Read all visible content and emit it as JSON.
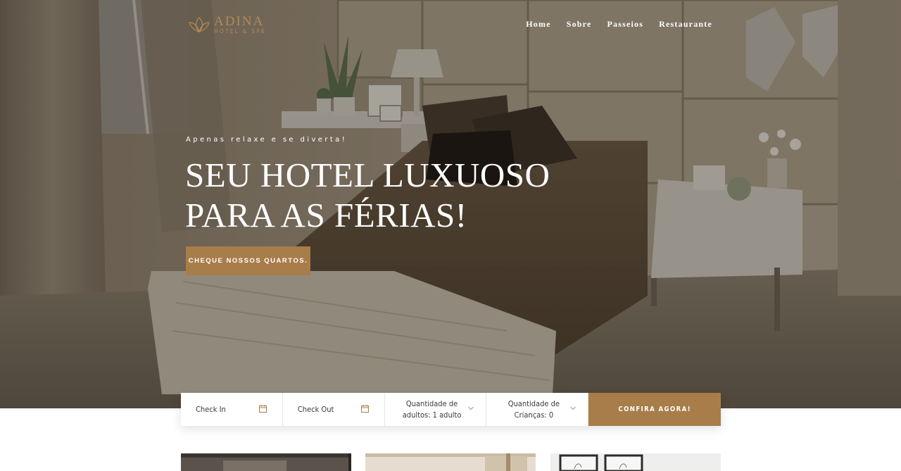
{
  "brand": {
    "name": "ADINA",
    "subtitle": "HOTEL & SPA",
    "accent": "#a87d49"
  },
  "nav": {
    "items": [
      "Home",
      "Sobre",
      "Passeios",
      "Restaurante"
    ]
  },
  "hero": {
    "tagline": "Apenas relaxe e se diverta!",
    "headline_line1": "SEU HOTEL LUXUOSO",
    "headline_line2": "PARA AS FÉRIAS!",
    "cta_label": "CHEQUE NOSSOS QUARTOS."
  },
  "booking": {
    "check_in": "Check In",
    "check_out": "Check Out",
    "adults_line1": "Quantidade de",
    "adults_line2": "adultos: 1 adulto",
    "children_line1": "Quantidade de",
    "children_line2": "Crianças: 0",
    "submit_label": "CONFIRA AGORA!"
  },
  "icons": {
    "calendar": "calendar-icon",
    "chevron": "chevron-down-icon",
    "logo": "lotus-logo-icon"
  }
}
